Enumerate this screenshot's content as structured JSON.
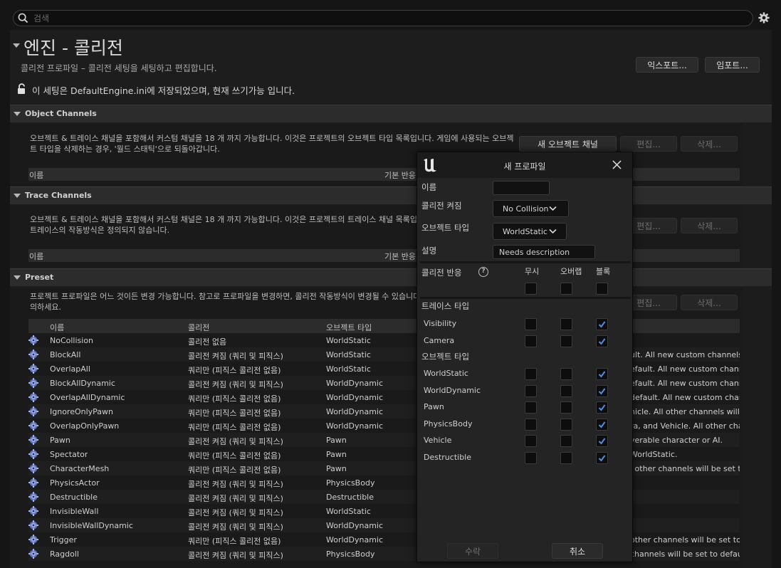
{
  "search": {
    "placeholder": "검색"
  },
  "header": {
    "title": "엔진 - 콜리전",
    "subtitle": "콜리전 프로파일 – 콜리전 세팅을 세팅하고 편집합니다.",
    "export_label": "익스포트...",
    "import_label": "임포트...",
    "save_note": "이 세팅은 DefaultEngine.ini에 저장되었으며, 현재 쓰기가능 입니다."
  },
  "object_channels": {
    "title": "Object Channels",
    "desc": "오브젝트 & 트레이스 채널을 포함해서 커스텀 채널을 18 개 까지 가능합니다. 이것은 프로젝트의 오브젝트 타입 목록입니다. 게임에 사용되는 오브젝트 타입을 삭제하는 경우, '월드 스태틱'으로 되돌아갑니다.",
    "new_label": "새 오브젝트 채널",
    "edit_label": "편집...",
    "delete_label": "삭제...",
    "col_name": "이름",
    "col_default": "기본 반응"
  },
  "trace_channels": {
    "title": "Trace Channels",
    "desc": "오브젝트 & 트레이스 채널을 포함해서 커스텀 채널은 18 개 까지 가능합니다. 이것은 프로젝트의 트레이스 채널 목록입니다. 채널을 삭제하는 경우, 트레이스의 작동방식은 정의되지 않습니다.",
    "edit_label": "편집...",
    "delete_label": "삭제...",
    "col_name": "이름",
    "col_default": "기본 반응"
  },
  "preset": {
    "title": "Preset",
    "desc": "프로젝트 프로파일은 어느 것이든 변경 가능합니다. 참고로 프로파일을 변경하면, 콜리전 작동방식이 변경될 수 있습니다. 프로파일을 변경할 때는 주의하세요.",
    "edit_label": "편집...",
    "delete_label": "삭제...",
    "columns": [
      "이름",
      "콜리전",
      "오브젝트 타입"
    ],
    "rows": [
      {
        "name": "NoCollision",
        "collision": "콜리전 없음",
        "type": "WorldStatic",
        "desc": ""
      },
      {
        "name": "BlockAll",
        "collision": "콜리전 켜짐 (쿼리 및 피직스)",
        "type": "WorldStatic",
        "desc": "ult. All new custom channels"
      },
      {
        "name": "OverlapAll",
        "collision": "쿼리만 (피직스 콜리전 없음)",
        "type": "WorldStatic",
        "desc": "efault. All new custom channel"
      },
      {
        "name": "BlockAllDynamic",
        "collision": "콜리전 켜짐 (쿼리 및 피직스)",
        "type": "WorldDynamic",
        "desc": "efault. All new custom channel"
      },
      {
        "name": "OverlapAllDynamic",
        "collision": "쿼리만 (피직스 콜리전 없음)",
        "type": "WorldDynamic",
        "desc": " default. All new custom chan"
      },
      {
        "name": "IgnoreOnlyPawn",
        "collision": "쿼리만 (피직스 콜리전 없음)",
        "type": "WorldDynamic",
        "desc": "hicle. All other channels will be"
      },
      {
        "name": "OverlapOnlyPawn",
        "collision": "쿼리만 (피직스 콜리전 없음)",
        "type": "WorldDynamic",
        "desc": "ra, and Vehicle. All other chan"
      },
      {
        "name": "Pawn",
        "collision": "콜리전 켜짐 (쿼리 및 피직스)",
        "type": "Pawn",
        "desc": "yerable character or AI."
      },
      {
        "name": "Spectator",
        "collision": "쿼리만 (피직스 콜리전 없음)",
        "type": "Pawn",
        "desc": " WorldStatic."
      },
      {
        "name": "CharacterMesh",
        "collision": "쿼리만 (피직스 콜리전 없음)",
        "type": "Pawn",
        "desc": "l other channels will be set to"
      },
      {
        "name": "PhysicsActor",
        "collision": "콜리전 켜짐 (쿼리 및 피직스)",
        "type": "PhysicsBody",
        "desc": ""
      },
      {
        "name": "Destructible",
        "collision": "콜리전 켜짐 (쿼리 및 피직스)",
        "type": "Destructible",
        "desc": ""
      },
      {
        "name": "InvisibleWall",
        "collision": "콜리전 켜짐 (쿼리 및 피직스)",
        "type": "WorldStatic",
        "desc": ""
      },
      {
        "name": "InvisibleWallDynamic",
        "collision": "콜리전 켜짐 (쿼리 및 피직스)",
        "type": "WorldDynamic",
        "desc": ""
      },
      {
        "name": "Trigger",
        "collision": "쿼리만 (피직스 콜리전 없음)",
        "type": "WorldDynamic",
        "desc": " other channels will be set to o"
      },
      {
        "name": "Ragdoll",
        "collision": "콜리전 켜짐 (쿼리 및 피직스)",
        "type": "PhysicsBody",
        "desc": " channels will be set to default"
      }
    ]
  },
  "dialog": {
    "title": "새 프로파일",
    "name_label": "이름",
    "name_value": "",
    "collision_enabled_label": "콜리전 켜짐",
    "collision_enabled_value": "No Collision",
    "object_type_label": "오브젝트 타입",
    "object_type_value": "WorldStatic",
    "description_label": "설명",
    "description_value": "Needs description",
    "response_label": "콜리전 반응",
    "col_ignore": "무시",
    "col_overlap": "오버랩",
    "col_block": "블록",
    "trace_type_label": "트레이스 타입",
    "trace_rows": [
      {
        "name": "Visibility",
        "ignore": false,
        "overlap": false,
        "block": true
      },
      {
        "name": "Camera",
        "ignore": false,
        "overlap": false,
        "block": true
      }
    ],
    "object_type_section_label": "오브젝트 타입",
    "object_rows": [
      {
        "name": "WorldStatic",
        "ignore": false,
        "overlap": false,
        "block": true
      },
      {
        "name": "WorldDynamic",
        "ignore": false,
        "overlap": false,
        "block": true
      },
      {
        "name": "Pawn",
        "ignore": false,
        "overlap": false,
        "block": true
      },
      {
        "name": "PhysicsBody",
        "ignore": false,
        "overlap": false,
        "block": true
      },
      {
        "name": "Vehicle",
        "ignore": false,
        "overlap": false,
        "block": true
      },
      {
        "name": "Destructible",
        "ignore": false,
        "overlap": false,
        "block": true
      }
    ],
    "accept_label": "수락",
    "cancel_label": "취소"
  }
}
